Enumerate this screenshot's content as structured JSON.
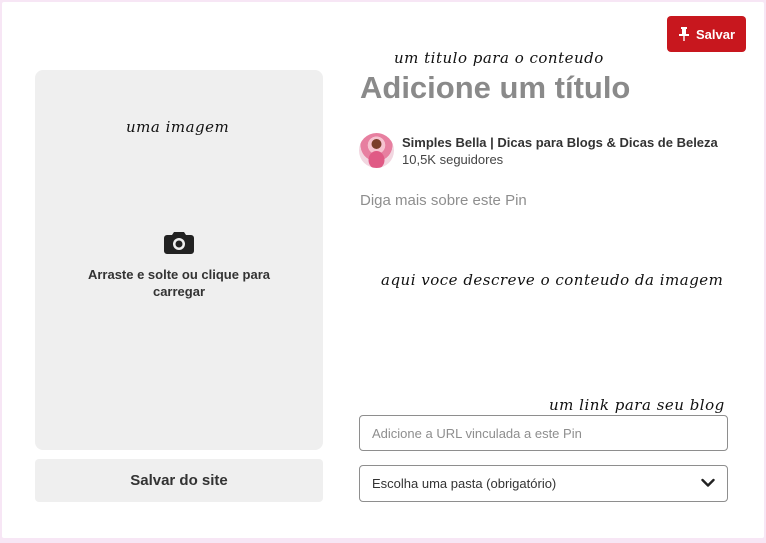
{
  "toolbar": {
    "save_label": "Salvar",
    "save_icon": "pin-icon",
    "accent": "#c8171e"
  },
  "upload": {
    "icon": "camera-icon",
    "hint": "Arraste e solte ou clique para carregar",
    "save_from_site": "Salvar do site"
  },
  "pin": {
    "title_placeholder": "Adicione um título",
    "owner_name": "Simples Bella | Dicas para Blogs & Dicas de Beleza",
    "followers": "10,5K seguidores",
    "description_placeholder": "Diga mais sobre este Pin",
    "url_placeholder": "Adicione a URL vinculada a este Pin",
    "board_placeholder": "Escolha uma pasta (obrigatório)"
  },
  "annotations": {
    "title_note": "um titulo para o conteudo",
    "image_note": "uma imagem",
    "description_note": "aqui voce descreve o conteudo da imagem",
    "link_note": "um link para seu blog"
  }
}
